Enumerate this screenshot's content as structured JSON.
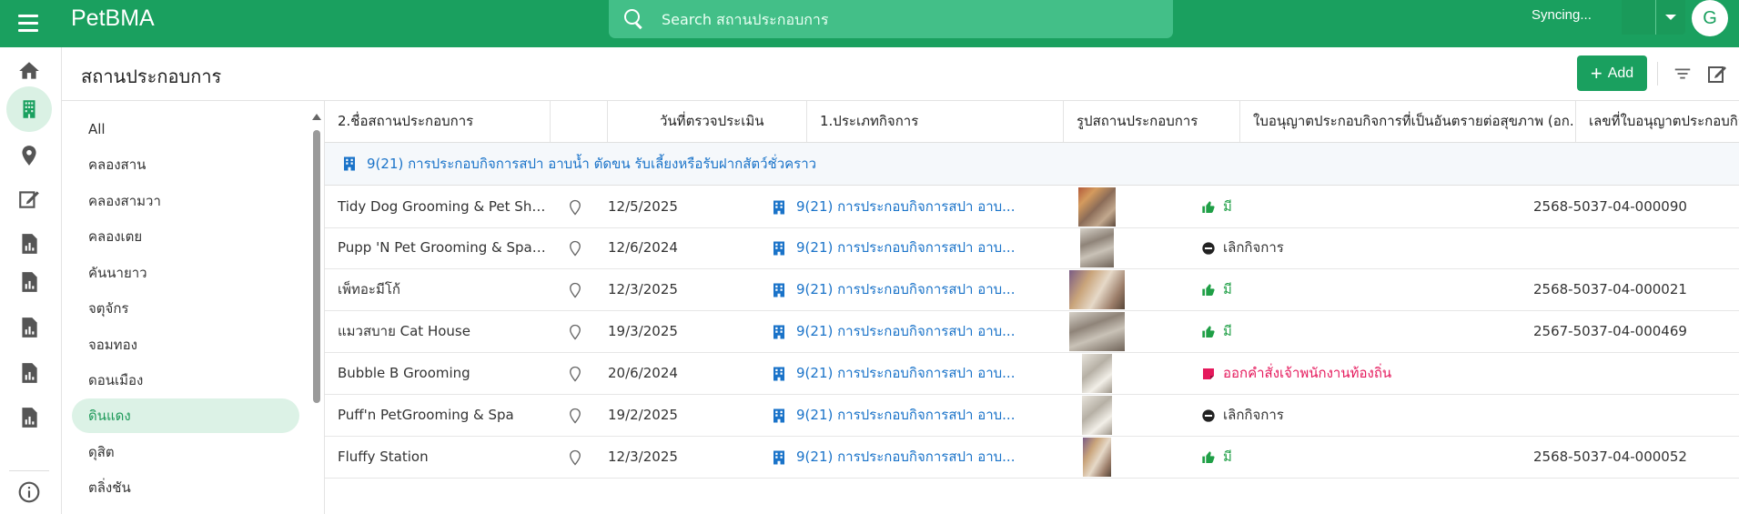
{
  "app": {
    "title": "PetBMA"
  },
  "search": {
    "placeholder": "Search สถานประกอบการ"
  },
  "topbar": {
    "sync_status": "Syncing...",
    "avatar_letter": "G"
  },
  "page": {
    "title": "สถานประกอบการ",
    "add_label": "Add"
  },
  "categories": [
    {
      "label": "All"
    },
    {
      "label": "คลองสาน"
    },
    {
      "label": "คลองสามวา"
    },
    {
      "label": "คลองเตย"
    },
    {
      "label": "คันนายาว"
    },
    {
      "label": "จตุจักร"
    },
    {
      "label": "จอมทอง"
    },
    {
      "label": "ดอนเมือง"
    },
    {
      "label": "ดินแดง",
      "active": true
    },
    {
      "label": "ดุสิต"
    },
    {
      "label": "ตลิ่งชัน"
    }
  ],
  "columns": {
    "name": "2.ชื่อสถานประกอบการ",
    "date": "วันที่ตรวจประเมิน",
    "type": "1.ประเภทกิจการ",
    "photo": "รูปสถานประกอบการ",
    "license": "ใบอนุญาตประกอบกิจการที่เป็นอันตรายต่อสุขภาพ (อก...",
    "license_no": "เลขที่ใบอนุญาตประกอบกิจการที่เป็น"
  },
  "group": {
    "label": "9(21) การประกอบกิจการสปา อาบน้ำ ตัดขน รับเลี้ยงหรือรับฝากสัตว์ชั่วคราว"
  },
  "rows": [
    {
      "name": "Tidy Dog Grooming & Pet Shop",
      "date": "12/5/2025",
      "type": "9(21) การประกอบกิจการสปา อาบ...",
      "license": "มี",
      "license_no": "2568-5037-04-000090"
    },
    {
      "name": "Pupp 'N Pet Grooming & Spa ...",
      "date": "12/6/2024",
      "type": "9(21) การประกอบกิจการสปา อาบ...",
      "license": "เลิกกิจการ",
      "license_no": ""
    },
    {
      "name": "เพ็ทอะมีโก้",
      "date": "12/3/2025",
      "type": "9(21) การประกอบกิจการสปา อาบ...",
      "license": "มี",
      "license_no": "2568-5037-04-000021"
    },
    {
      "name": "แมวสบาย Cat House",
      "date": "19/3/2025",
      "type": "9(21) การประกอบกิจการสปา อาบ...",
      "license": "มี",
      "license_no": "2567-5037-04-000469"
    },
    {
      "name": "Bubble B Grooming",
      "date": "20/6/2024",
      "type": "9(21) การประกอบกิจการสปา อาบ...",
      "license": "ออกคำสั่งเจ้าพนักงานท้องถิ่น",
      "license_no": ""
    },
    {
      "name": "Puff'n PetGrooming & Spa",
      "date": "19/2/2025",
      "type": "9(21) การประกอบกิจการสปา อาบ...",
      "license": "เลิกกิจการ",
      "license_no": ""
    },
    {
      "name": "Fluffy Station",
      "date": "12/3/2025",
      "type": "9(21) การประกอบกิจการสปา อาบ...",
      "license": "มี",
      "license_no": "2568-5037-04-000052"
    }
  ],
  "colors": {
    "brand": "#1aa05f",
    "link": "#1a73c9",
    "status_yes": "#1f9f46",
    "status_order": "#e5195c"
  }
}
